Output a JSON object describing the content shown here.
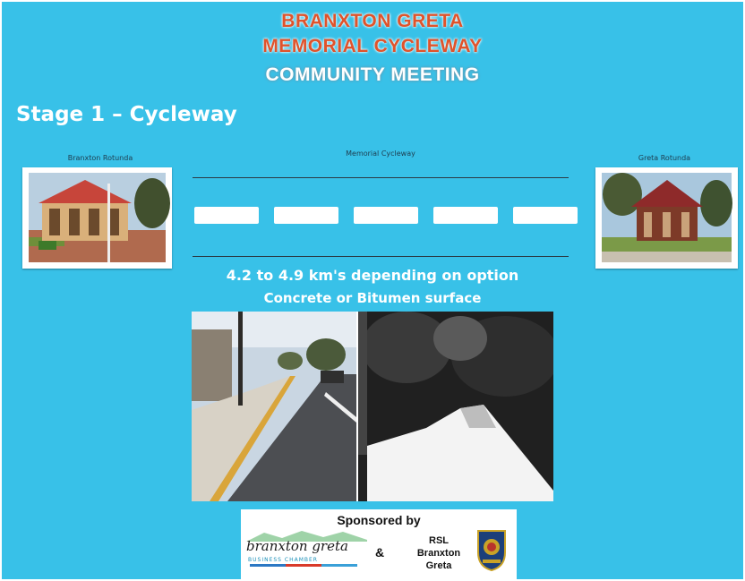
{
  "title": {
    "line1": "BRANXTON GRETA",
    "line2": "MEMORIAL CYCLEWAY",
    "line3": "COMMUNITY MEETING"
  },
  "stage_heading": "Stage 1 – Cycleway",
  "route": {
    "left_label": "Branxton Rotunda",
    "center_label": "Memorial Cycleway",
    "right_label": "Greta Rotunda"
  },
  "info": {
    "distance": "4.2 to 4.9 km's depending on option",
    "surface": "Concrete or Bitumen surface"
  },
  "sponsor": {
    "heading": "Sponsored by",
    "logo_text": "branxton greta",
    "logo_sub": "BUSINESS CHAMBER",
    "ampersand": "&",
    "rsl_line1": "RSL",
    "rsl_line2": "Branxton",
    "rsl_line3": "Greta"
  },
  "colors": {
    "background": "#38c1e8",
    "title_accent": "#e0532b"
  }
}
